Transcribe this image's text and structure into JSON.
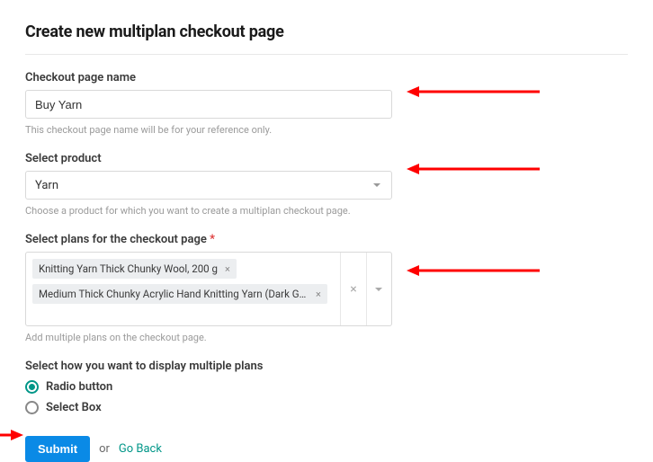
{
  "title": "Create new multiplan checkout page",
  "checkout_name": {
    "label": "Checkout page name",
    "value": "Buy Yarn",
    "help": "This checkout page name will be for your reference only."
  },
  "product": {
    "label": "Select product",
    "value": "Yarn",
    "help": "Choose a product for which you want to create a multiplan checkout page."
  },
  "plans": {
    "label": "Select plans for the checkout page",
    "required": "*",
    "help": "Add multiple plans on the checkout page.",
    "chips": [
      "Knitting Yarn Thick Chunky Wool, 200 g",
      "Medium Thick Chunky Acrylic Hand Knitting Yarn (Dark Gre..."
    ]
  },
  "display_mode": {
    "label": "Select how you want to display multiple plans",
    "options": {
      "radio": "Radio button",
      "select": "Select Box"
    }
  },
  "footer": {
    "submit": "Submit",
    "or": "or",
    "goback": "Go Back"
  }
}
